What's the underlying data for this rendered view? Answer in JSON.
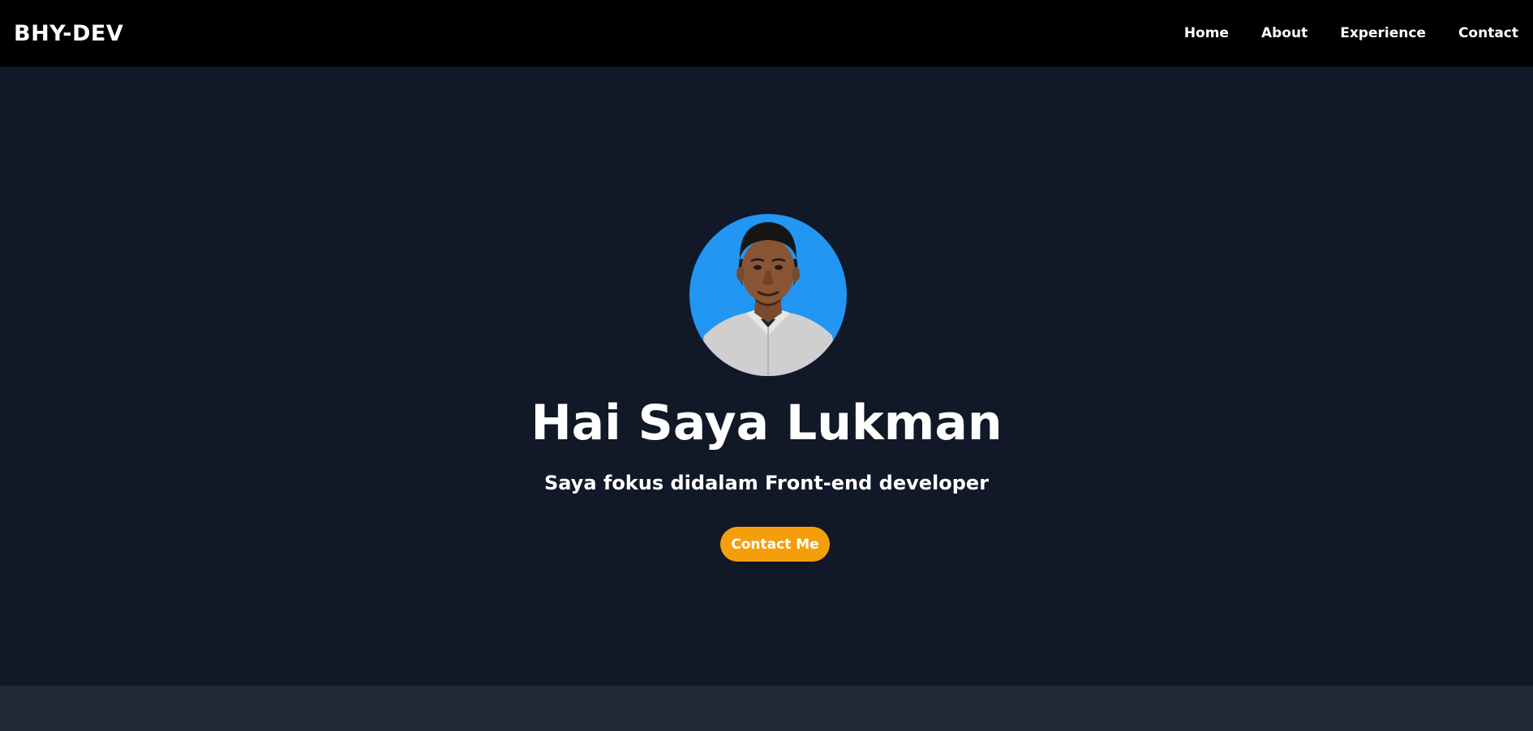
{
  "navbar": {
    "brand": "BHY-DEV",
    "links": [
      {
        "label": "Home"
      },
      {
        "label": "About"
      },
      {
        "label": "Experience"
      },
      {
        "label": "Contact"
      }
    ]
  },
  "hero": {
    "avatar_alt": "profile-photo",
    "title": "Hai Saya Lukman",
    "subtitle": "Saya fokus didalam Front-end developer",
    "cta_label": "Contact Me"
  },
  "colors": {
    "navbar_bg": "#000000",
    "hero_bg": "#111827",
    "avatar_bg": "#2196f3",
    "cta_bg": "#f59e0b",
    "next_section_bg": "#1f2937"
  }
}
